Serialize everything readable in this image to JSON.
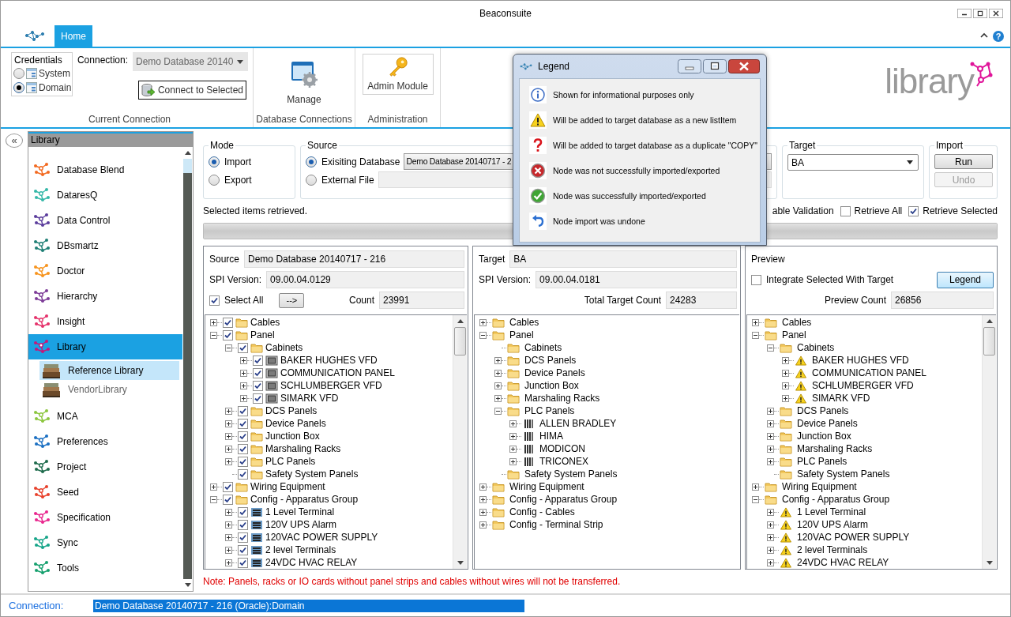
{
  "window": {
    "title": "Beaconsuite",
    "help_button": "?"
  },
  "ribbon": {
    "tabs": [
      {
        "label": "Home",
        "selected": true
      }
    ],
    "credentials": {
      "title": "Credentials",
      "options": [
        {
          "label": "System",
          "selected": false
        },
        {
          "label": "Domain",
          "selected": true
        }
      ]
    },
    "connection": {
      "label": "Connection:",
      "value": "Demo Database 20140",
      "disabled": true
    },
    "connect_button": "Connect to Selected",
    "groups": [
      "Current Connection",
      "Database Connections",
      "Administration"
    ],
    "manage_button": "Manage",
    "admin_button": "Admin Module",
    "logo_text": "library"
  },
  "sidebar": {
    "collapse_button": "«",
    "header": "Library",
    "items": [
      {
        "label": "Database Blend",
        "color": "#f26a21",
        "selected": false
      },
      {
        "label": "DataresQ",
        "color": "#35b8a8",
        "selected": false
      },
      {
        "label": "Data Control",
        "color": "#5b3d9c",
        "selected": false
      },
      {
        "label": "DBsmartz",
        "color": "#1f7f75",
        "selected": false
      },
      {
        "label": "Doctor",
        "color": "#f7941e",
        "selected": false
      },
      {
        "label": "Hierarchy",
        "color": "#7d3c98",
        "selected": false
      },
      {
        "label": "Insight",
        "color": "#e5326b",
        "selected": false
      },
      {
        "label": "Library",
        "color": "#c4187a",
        "selected": true,
        "children": [
          {
            "label": "Reference Library",
            "selected": true
          },
          {
            "label": "VendorLibrary",
            "selected": false
          }
        ]
      },
      {
        "label": "MCA",
        "color": "#8cc63e",
        "selected": false
      },
      {
        "label": "Preferences",
        "color": "#1b6fc2",
        "selected": false
      },
      {
        "label": "Project",
        "color": "#1e6b4c",
        "selected": false
      },
      {
        "label": "Seed",
        "color": "#e8412c",
        "selected": false
      },
      {
        "label": "Specification",
        "color": "#e9268e",
        "selected": false
      },
      {
        "label": "Sync",
        "color": "#17a589",
        "selected": false
      },
      {
        "label": "Tools",
        "color": "#16a06e",
        "selected": false
      }
    ]
  },
  "mode": {
    "title": "Mode",
    "options": [
      {
        "label": "Import",
        "selected": true
      },
      {
        "label": "Export",
        "selected": false
      }
    ]
  },
  "source": {
    "title": "Source",
    "options": [
      {
        "label": "Exisiting Database",
        "selected": true,
        "value": "Demo Database 20140717 - 2"
      },
      {
        "label": "External File",
        "selected": false
      }
    ]
  },
  "target": {
    "title": "Target",
    "value": "BA"
  },
  "import": {
    "title": "Import",
    "buttons": [
      {
        "label": "Run",
        "disabled": false
      },
      {
        "label": "Undo",
        "disabled": true
      }
    ]
  },
  "status_message": "Selected items retrieved.",
  "progress": {
    "level": 1
  },
  "validation_label": "able Validation",
  "retrieve_options": [
    {
      "label": "Retrieve All",
      "checked": false
    },
    {
      "label": "Retrieve Selected",
      "checked": true
    }
  ],
  "source_panel": {
    "source_label": "Source",
    "source_value": "Demo Database 20140717 - 216",
    "spi_label": "SPI Version:",
    "spi_value": "09.00.04.0129",
    "select_all": {
      "label": "Select All",
      "checked": true
    },
    "transfer_button": "-->",
    "count_label": "Count",
    "count_value": "23991",
    "tree": [
      {
        "label": "Cables",
        "kind": "folder",
        "expanded": false,
        "checked": true
      },
      {
        "label": "Panel",
        "kind": "folder",
        "expanded": true,
        "checked": true,
        "children": [
          {
            "label": "Cabinets",
            "kind": "folder",
            "expanded": true,
            "checked": true,
            "children": [
              {
                "label": "BAKER HUGHES VFD",
                "kind": "cabinet",
                "expanded": false,
                "checked": true
              },
              {
                "label": "COMMUNICATION PANEL",
                "kind": "cabinet",
                "expanded": false,
                "checked": true
              },
              {
                "label": "SCHLUMBERGER VFD",
                "kind": "cabinet",
                "expanded": false,
                "checked": true
              },
              {
                "label": "SIMARK VFD",
                "kind": "cabinet",
                "expanded": false,
                "checked": true
              }
            ]
          },
          {
            "label": "DCS Panels",
            "kind": "folder",
            "expanded": false,
            "checked": true
          },
          {
            "label": "Device Panels",
            "kind": "folder",
            "expanded": false,
            "checked": true
          },
          {
            "label": "Junction Box",
            "kind": "folder",
            "expanded": false,
            "checked": true
          },
          {
            "label": "Marshaling Racks",
            "kind": "folder",
            "expanded": false,
            "checked": true
          },
          {
            "label": "PLC Panels",
            "kind": "folder",
            "expanded": false,
            "checked": true
          },
          {
            "label": "Safety System Panels",
            "kind": "folder",
            "checked": true
          }
        ]
      },
      {
        "label": "Wiring Equipment",
        "kind": "folder",
        "expanded": false,
        "checked": true
      },
      {
        "label": "Config - Apparatus Group",
        "kind": "folder",
        "expanded": true,
        "checked": true,
        "children": [
          {
            "label": "1 Level Terminal",
            "kind": "terminal",
            "expanded": false,
            "checked": true
          },
          {
            "label": "120V UPS Alarm",
            "kind": "terminal",
            "expanded": false,
            "checked": true
          },
          {
            "label": "120VAC POWER SUPPLY",
            "kind": "terminal",
            "expanded": false,
            "checked": true
          },
          {
            "label": "2 level Terminals",
            "kind": "terminal",
            "expanded": false,
            "checked": true
          },
          {
            "label": "24VDC HVAC RELAY",
            "kind": "terminal",
            "expanded": false,
            "checked": true
          }
        ]
      }
    ]
  },
  "target_panel": {
    "target_label": "Target",
    "target_value": "BA",
    "spi_label": "SPI Version:",
    "spi_value": "09.00.04.0181",
    "count_label": "Total Target Count",
    "count_value": "24283",
    "tree": [
      {
        "label": "Cables",
        "kind": "folder",
        "expanded": false
      },
      {
        "label": "Panel",
        "kind": "folder",
        "expanded": true,
        "children": [
          {
            "label": "Cabinets",
            "kind": "folder"
          },
          {
            "label": "DCS Panels",
            "kind": "folder",
            "expanded": false
          },
          {
            "label": "Device Panels",
            "kind": "folder",
            "expanded": false
          },
          {
            "label": "Junction Box",
            "kind": "folder",
            "expanded": false
          },
          {
            "label": "Marshaling Racks",
            "kind": "folder",
            "expanded": false
          },
          {
            "label": "PLC Panels",
            "kind": "folder",
            "expanded": true,
            "children": [
              {
                "label": "ALLEN BRADLEY",
                "kind": "plc",
                "expanded": false
              },
              {
                "label": "HIMA",
                "kind": "plc",
                "expanded": false
              },
              {
                "label": "MODICON",
                "kind": "plc",
                "expanded": false
              },
              {
                "label": "TRICONEX",
                "kind": "plc",
                "expanded": false
              }
            ]
          },
          {
            "label": "Safety System Panels",
            "kind": "folder"
          }
        ]
      },
      {
        "label": "Wiring Equipment",
        "kind": "folder",
        "expanded": false
      },
      {
        "label": "Config - Apparatus Group",
        "kind": "folder",
        "expanded": false
      },
      {
        "label": "Config - Cables",
        "kind": "folder",
        "expanded": false
      },
      {
        "label": "Config - Terminal Strip",
        "kind": "folder",
        "expanded": false
      }
    ]
  },
  "preview_panel": {
    "title": "Preview",
    "integrate": {
      "label": "Integrate Selected With Target",
      "checked": false
    },
    "legend_button": "Legend",
    "count_label": "Preview Count",
    "count_value": "26856",
    "tree": [
      {
        "label": "Cables",
        "kind": "folder",
        "expanded": false
      },
      {
        "label": "Panel",
        "kind": "folder",
        "expanded": true,
        "children": [
          {
            "label": "Cabinets",
            "kind": "folder",
            "expanded": true,
            "children": [
              {
                "label": "BAKER HUGHES VFD",
                "kind": "warning",
                "expanded": false
              },
              {
                "label": "COMMUNICATION PANEL",
                "kind": "warning",
                "expanded": false
              },
              {
                "label": "SCHLUMBERGER VFD",
                "kind": "warning",
                "expanded": false
              },
              {
                "label": "SIMARK VFD",
                "kind": "warning",
                "expanded": false
              }
            ]
          },
          {
            "label": "DCS Panels",
            "kind": "folder",
            "expanded": false
          },
          {
            "label": "Device Panels",
            "kind": "folder",
            "expanded": false
          },
          {
            "label": "Junction Box",
            "kind": "folder",
            "expanded": false
          },
          {
            "label": "Marshaling Racks",
            "kind": "folder",
            "expanded": false
          },
          {
            "label": "PLC Panels",
            "kind": "folder",
            "expanded": false
          },
          {
            "label": "Safety System Panels",
            "kind": "folder"
          }
        ]
      },
      {
        "label": "Wiring Equipment",
        "kind": "folder",
        "expanded": false
      },
      {
        "label": "Config - Apparatus Group",
        "kind": "folder",
        "expanded": true,
        "children": [
          {
            "label": "1 Level Terminal",
            "kind": "warning",
            "expanded": false
          },
          {
            "label": "120V UPS Alarm",
            "kind": "warning",
            "expanded": false
          },
          {
            "label": "120VAC POWER SUPPLY",
            "kind": "warning",
            "expanded": false
          },
          {
            "label": "2 level Terminals",
            "kind": "warning",
            "expanded": false
          },
          {
            "label": "24VDC HVAC RELAY",
            "kind": "warning",
            "expanded": false
          }
        ]
      }
    ]
  },
  "note": "Note: Panels, racks or IO cards without panel strips and cables without wires will not be transferred.",
  "status_bar": {
    "label": "Connection:",
    "value": "Demo Database 20140717 - 216 (Oracle):Domain"
  },
  "legend": {
    "title": "Legend",
    "items": [
      {
        "kind": "info",
        "text": "Shown for informational purposes only"
      },
      {
        "kind": "warning",
        "text": "Will be added to target database as a new listItem"
      },
      {
        "kind": "question",
        "text": "Will be added to target database as a duplicate \"COPY\""
      },
      {
        "kind": "error",
        "text": "Node was not successfully imported/exported"
      },
      {
        "kind": "success",
        "text": "Node was successfully imported/exported"
      },
      {
        "kind": "undo",
        "text": "Node import was undone"
      }
    ]
  }
}
